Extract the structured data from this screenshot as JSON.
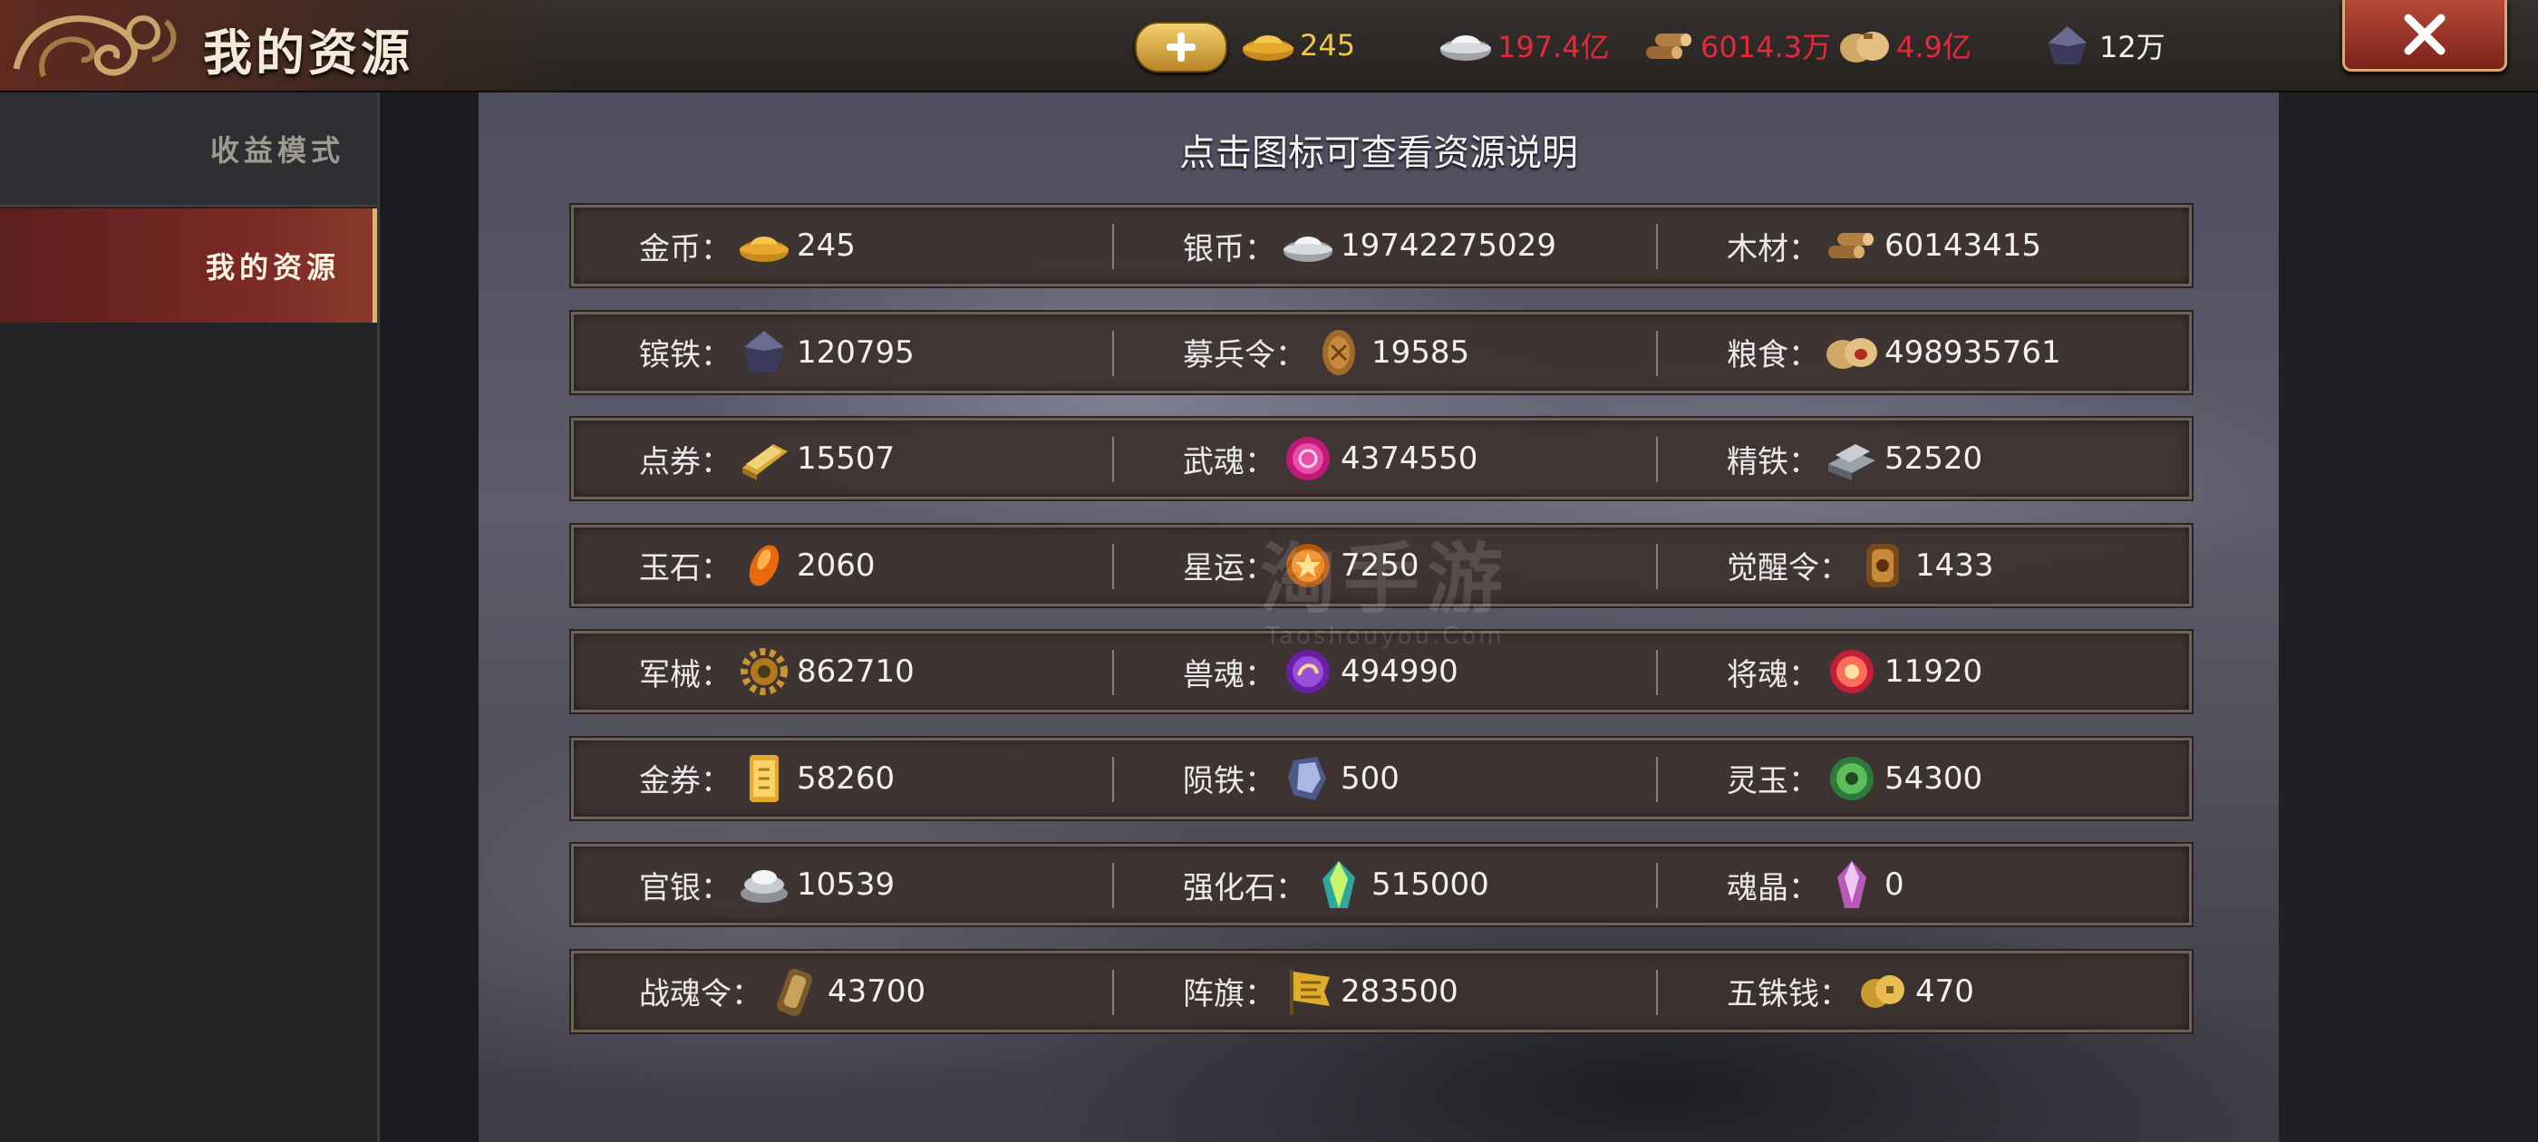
{
  "header": {
    "title": "我的资源",
    "topbar_resources": [
      {
        "icon": "gold-ingot-icon",
        "value": "245",
        "color": "gold"
      },
      {
        "icon": "silver-ingot-icon",
        "value": "197.4亿",
        "color": "red"
      },
      {
        "icon": "wood-logs-icon",
        "value": "6014.3万",
        "color": "red"
      },
      {
        "icon": "grain-sack-icon",
        "value": "4.9亿",
        "color": "red"
      },
      {
        "icon": "iron-ore-icon",
        "value": "12万",
        "color": "white"
      }
    ]
  },
  "sidebar": {
    "tabs": [
      {
        "label": "收益模式",
        "active": false
      },
      {
        "label": "我的资源",
        "active": true
      }
    ]
  },
  "main": {
    "hint": "点击图标可查看资源说明",
    "rows": [
      [
        {
          "label": "金币：",
          "icon": "gold-ingot-icon",
          "value": "245"
        },
        {
          "label": "银币：",
          "icon": "silver-ingot-icon",
          "value": "19742275029"
        },
        {
          "label": "木材：",
          "icon": "wood-logs-icon",
          "value": "60143415"
        }
      ],
      [
        {
          "label": "镔铁：",
          "icon": "iron-ore-icon",
          "value": "120795"
        },
        {
          "label": "募兵令：",
          "icon": "recruit-token-icon",
          "value": "19585"
        },
        {
          "label": "粮食：",
          "icon": "grain-sack-icon",
          "value": "498935761"
        }
      ],
      [
        {
          "label": "点券：",
          "icon": "gold-bars-icon",
          "value": "15507"
        },
        {
          "label": "武魂：",
          "icon": "martial-soul-icon",
          "value": "4374550"
        },
        {
          "label": "精铁：",
          "icon": "refined-iron-icon",
          "value": "52520"
        }
      ],
      [
        {
          "label": "玉石：",
          "icon": "jade-stone-icon",
          "value": "2060"
        },
        {
          "label": "星运：",
          "icon": "star-fortune-icon",
          "value": "7250"
        },
        {
          "label": "觉醒令：",
          "icon": "awaken-token-icon",
          "value": "1433"
        }
      ],
      [
        {
          "label": "军械：",
          "icon": "gear-icon",
          "value": "862710"
        },
        {
          "label": "兽魂：",
          "icon": "beast-soul-icon",
          "value": "494990"
        },
        {
          "label": "将魂：",
          "icon": "general-soul-icon",
          "value": "11920"
        }
      ],
      [
        {
          "label": "金券：",
          "icon": "gold-scroll-icon",
          "value": "58260"
        },
        {
          "label": "陨铁：",
          "icon": "meteor-iron-icon",
          "value": "500"
        },
        {
          "label": "灵玉：",
          "icon": "spirit-jade-icon",
          "value": "54300"
        }
      ],
      [
        {
          "label": "官银：",
          "icon": "official-silver-icon",
          "value": "10539"
        },
        {
          "label": "强化石：",
          "icon": "enhance-stone-icon",
          "value": "515000"
        },
        {
          "label": "魂晶：",
          "icon": "soul-crystal-icon",
          "value": "0"
        }
      ],
      [
        {
          "label": "战魂令：",
          "icon": "war-soul-token-icon",
          "value": "43700"
        },
        {
          "label": "阵旗：",
          "icon": "battle-flag-icon",
          "value": "283500"
        },
        {
          "label": "五铢钱：",
          "icon": "wuzhu-coins-icon",
          "value": "470"
        }
      ]
    ]
  },
  "watermark": {
    "line1": "淘手游",
    "line2": "Taoshouyou.Com"
  },
  "colors": {
    "gold": "#f2c64a",
    "red": "#e8283a",
    "white": "#f2f2f2",
    "active_tab": "#7b2a26"
  }
}
